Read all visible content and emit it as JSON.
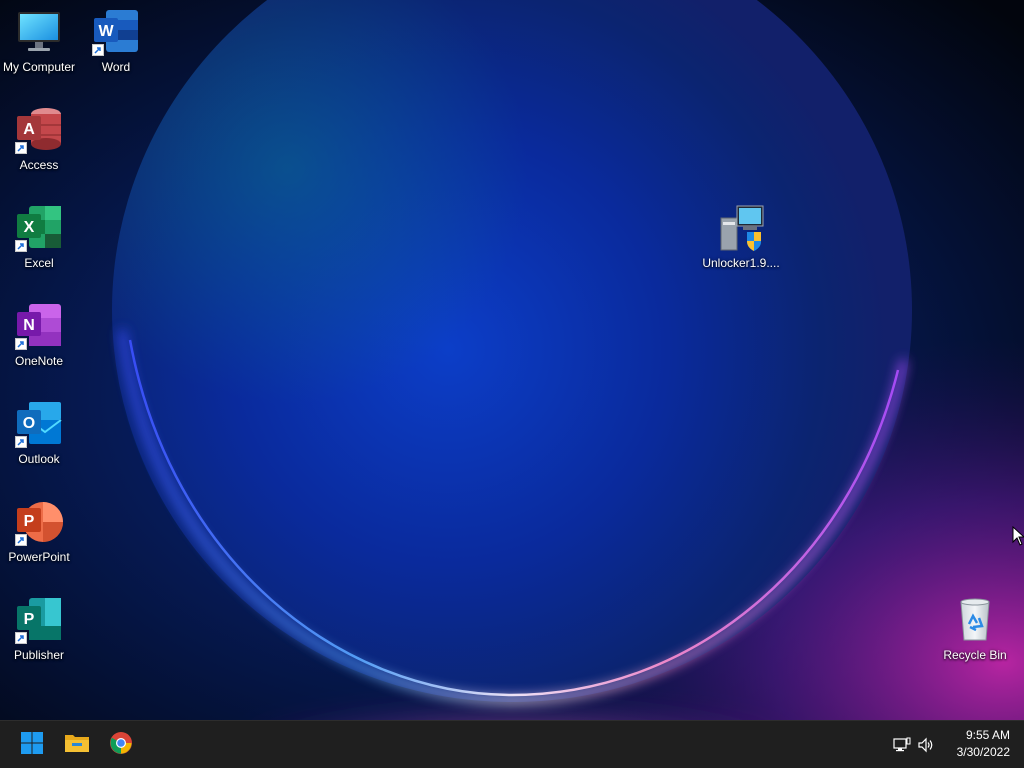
{
  "desktop": {
    "wallpaper": "windows-11-bloom-dark",
    "icons": [
      {
        "label": "My Computer",
        "icon": "monitor-icon"
      },
      {
        "label": "Word",
        "icon": "word-icon"
      },
      {
        "label": "Access",
        "icon": "access-icon"
      },
      {
        "label": "Excel",
        "icon": "excel-icon"
      },
      {
        "label": "OneNote",
        "icon": "onenote-icon"
      },
      {
        "label": "Outlook",
        "icon": "outlook-icon"
      },
      {
        "label": "PowerPoint",
        "icon": "powerpoint-icon"
      },
      {
        "label": "Publisher",
        "icon": "publisher-icon"
      },
      {
        "label": "Unlocker1.9....",
        "icon": "installer-icon"
      },
      {
        "label": "Recycle Bin",
        "icon": "recycle-bin-icon"
      }
    ]
  },
  "taskbar": {
    "pinned": [
      {
        "name": "Start",
        "icon": "windows-start-icon"
      },
      {
        "name": "File Explorer",
        "icon": "folder-icon"
      },
      {
        "name": "Google Chrome",
        "icon": "chrome-icon"
      }
    ],
    "tray": {
      "network_icon": "network-icon",
      "volume_icon": "volume-icon",
      "time": "9:55 AM",
      "date": "3/30/2022"
    }
  },
  "colors": {
    "taskbar_bg": "#1f1f1f",
    "word": "#185abd",
    "access": "#a4373a",
    "excel": "#107c41",
    "onenote": "#7719aa",
    "outlook": "#0f6cbd",
    "powerpoint": "#c43e1c",
    "publisher": "#077568",
    "start_blue": "#1e9bf0",
    "folder_yellow": "#f5c033"
  }
}
